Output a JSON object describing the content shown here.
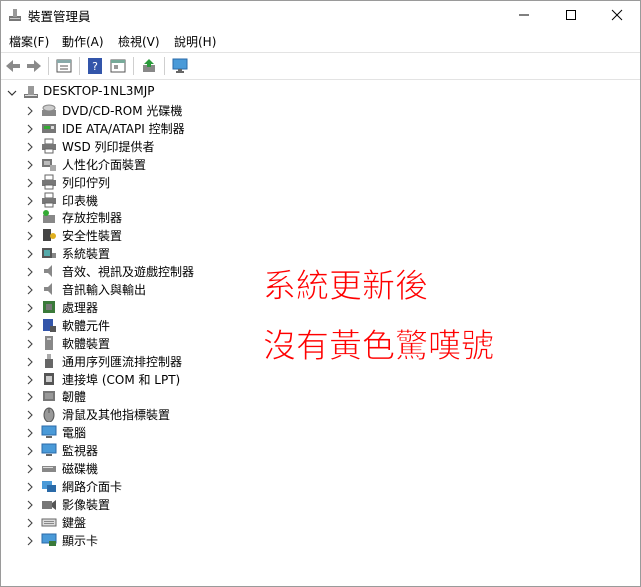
{
  "window": {
    "title": "裝置管理員"
  },
  "menu": [
    {
      "label": "檔案(F)"
    },
    {
      "label": "動作(A)"
    },
    {
      "label": "檢視(V)"
    },
    {
      "label": "說明(H)"
    }
  ],
  "toolbar": {
    "buttons": [
      "back-icon",
      "forward-icon",
      "properties-icon",
      "help-icon",
      "view-icon",
      "update-driver-icon",
      "monitor-scan-icon"
    ]
  },
  "tree": {
    "root": "DESKTOP-1NL3MJP",
    "items": [
      {
        "label": "DVD/CD-ROM 光碟機",
        "icon": "dvd-icon"
      },
      {
        "label": "IDE ATA/ATAPI 控制器",
        "icon": "ide-controller-icon"
      },
      {
        "label": "WSD 列印提供者",
        "icon": "printer-icon"
      },
      {
        "label": "人性化介面裝置",
        "icon": "hid-icon"
      },
      {
        "label": "列印佇列",
        "icon": "printer-icon"
      },
      {
        "label": "印表機",
        "icon": "printer-icon"
      },
      {
        "label": "存放控制器",
        "icon": "storage-controller-icon"
      },
      {
        "label": "安全性裝置",
        "icon": "security-icon"
      },
      {
        "label": "系統裝置",
        "icon": "system-device-icon"
      },
      {
        "label": "音效、視訊及遊戲控制器",
        "icon": "speaker-icon"
      },
      {
        "label": "音訊輸入與輸出",
        "icon": "speaker-icon"
      },
      {
        "label": "處理器",
        "icon": "processor-icon"
      },
      {
        "label": "軟體元件",
        "icon": "software-component-icon"
      },
      {
        "label": "軟體裝置",
        "icon": "software-device-icon"
      },
      {
        "label": "通用序列匯流排控制器",
        "icon": "usb-icon"
      },
      {
        "label": "連接埠 (COM 和 LPT)",
        "icon": "port-icon"
      },
      {
        "label": "韌體",
        "icon": "firmware-icon"
      },
      {
        "label": "滑鼠及其他指標裝置",
        "icon": "mouse-icon"
      },
      {
        "label": "電腦",
        "icon": "computer-icon"
      },
      {
        "label": "監視器",
        "icon": "monitor-icon"
      },
      {
        "label": "磁碟機",
        "icon": "disk-icon"
      },
      {
        "label": "網路介面卡",
        "icon": "network-icon"
      },
      {
        "label": "影像裝置",
        "icon": "camera-icon"
      },
      {
        "label": "鍵盤",
        "icon": "keyboard-icon"
      },
      {
        "label": "顯示卡",
        "icon": "display-adapter-icon"
      }
    ]
  },
  "annotation": {
    "line1": "系統更新後",
    "line2": "沒有黃色驚嘆號"
  },
  "colors": {
    "annotation": "#ff0000",
    "icon_blue": "#1e78c8"
  }
}
